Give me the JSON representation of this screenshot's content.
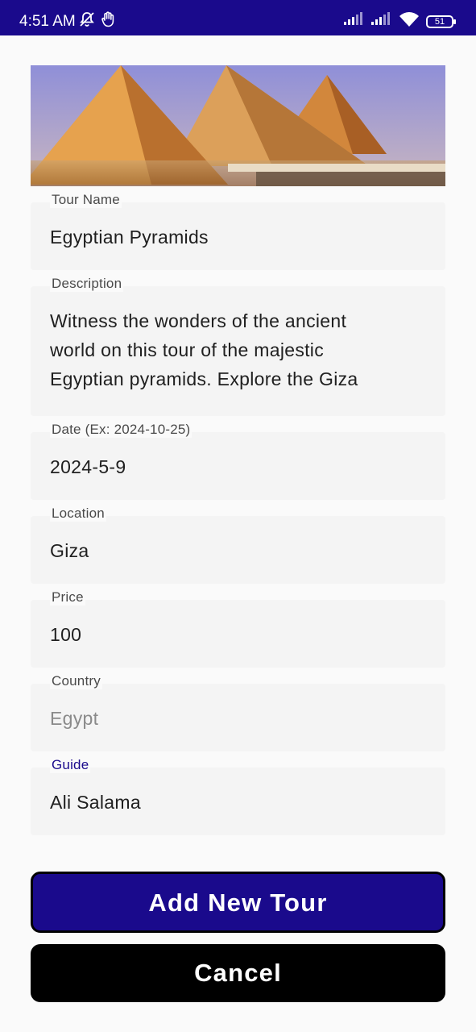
{
  "status_bar": {
    "time": "4:51 AM",
    "battery": "51",
    "icons": [
      "notifications-off-icon",
      "hand-icon",
      "signal-icon",
      "signal-icon",
      "wifi-icon",
      "battery-icon"
    ]
  },
  "header_image": {
    "icon": "pyramids-image"
  },
  "form": {
    "tour_name": {
      "label": "Tour Name",
      "value": "Egyptian Pyramids"
    },
    "description": {
      "label": "Description",
      "lines": [
        "Witness the wonders of the ancient",
        "world on this tour of the majestic",
        "Egyptian pyramids. Explore the Giza"
      ]
    },
    "date": {
      "label": "Date (Ex: 2024-10-25)",
      "value": "2024-5-9"
    },
    "location": {
      "label": "Location",
      "value": "Giza"
    },
    "price": {
      "label": "Price",
      "value": "100"
    },
    "country": {
      "label": "Country",
      "placeholder": "Egypt"
    },
    "guide": {
      "label": "Guide",
      "value": "Ali Salama"
    }
  },
  "buttons": {
    "add": "Add New Tour",
    "cancel": "Cancel"
  },
  "colors": {
    "primary": "#1a0a8c",
    "field_bg": "#f4f4f4",
    "page_bg": "#fafafa",
    "cancel_bg": "#000000"
  }
}
